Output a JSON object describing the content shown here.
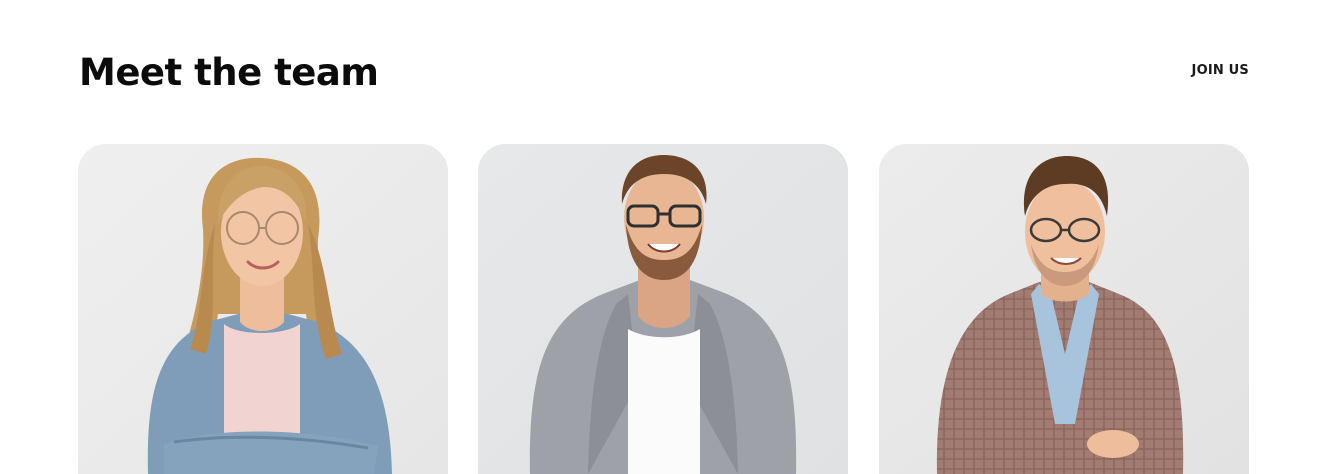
{
  "section": {
    "title": "Meet the team",
    "join_label": "JOIN US"
  },
  "team": [
    {
      "photo": "team-member-photo-1"
    },
    {
      "photo": "team-member-photo-2"
    },
    {
      "photo": "team-member-photo-3"
    }
  ]
}
